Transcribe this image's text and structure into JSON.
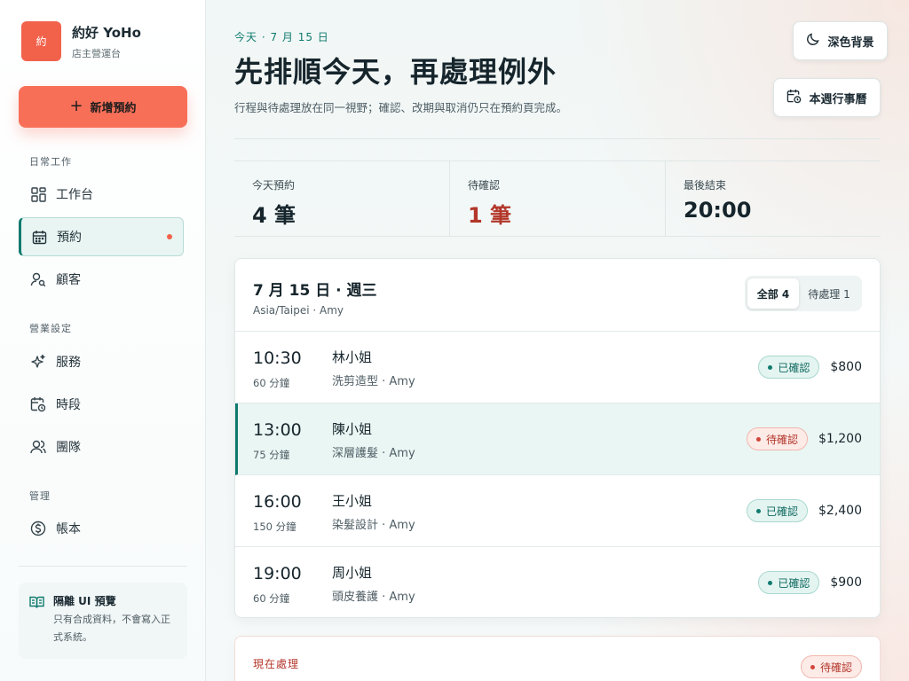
{
  "brand": {
    "logo_text": "約",
    "name": "約好 YoHo",
    "subtitle": "店主營運台",
    "accent": "#f2624b"
  },
  "sidebar": {
    "new_button": "新增預約",
    "sections": [
      {
        "label": "日常工作",
        "items": [
          {
            "label": "工作台",
            "icon": "grid-icon"
          },
          {
            "label": "預約",
            "icon": "calendar-icon",
            "active": true,
            "has_dot": true
          },
          {
            "label": "顧客",
            "icon": "user-search-icon"
          }
        ]
      },
      {
        "label": "營業設定",
        "items": [
          {
            "label": "服務",
            "icon": "sparkles-icon"
          },
          {
            "label": "時段",
            "icon": "calendar-clock-icon"
          },
          {
            "label": "團隊",
            "icon": "users-icon"
          }
        ]
      },
      {
        "label": "管理",
        "items": [
          {
            "label": "帳本",
            "icon": "dollar-circle-icon"
          }
        ]
      }
    ],
    "note": {
      "title": "隔離 UI 預覽",
      "body": "只有合成資料，不會寫入正式系統。",
      "icon": "book-icon"
    }
  },
  "header": {
    "kicker": "今天 · 7 月 15 日",
    "title": "先排順今天，再處理例外",
    "description": "行程與待處理放在同一視野；確認、改期與取消仍只在預約頁完成。",
    "dark_mode_button": "深色背景",
    "week_button": "本週行事曆"
  },
  "stats": [
    {
      "label": "今天預約",
      "value": "4 筆"
    },
    {
      "label": "待確認",
      "value": "1 筆",
      "warn": true
    },
    {
      "label": "最後結束",
      "value": "20:00"
    }
  ],
  "schedule": {
    "date": "7 月 15 日 · 週三",
    "subtitle": "Asia/Taipei · Amy",
    "filters": [
      {
        "label": "全部 4",
        "active": true
      },
      {
        "label": "待處理 1",
        "active": false
      }
    ],
    "appointments": [
      {
        "time": "10:30",
        "duration": "60 分鐘",
        "customer": "林小姐",
        "service": "洗剪造型 · Amy",
        "status": "已確認",
        "status_type": "ok",
        "price": "$800"
      },
      {
        "time": "13:00",
        "duration": "75 分鐘",
        "customer": "陳小姐",
        "service": "深層護髮 · Amy",
        "status": "待確認",
        "status_type": "pending",
        "price": "$1,200",
        "selected": true
      },
      {
        "time": "16:00",
        "duration": "150 分鐘",
        "customer": "王小姐",
        "service": "染髮設計 · Amy",
        "status": "已確認",
        "status_type": "ok",
        "price": "$2,400"
      },
      {
        "time": "19:00",
        "duration": "60 分鐘",
        "customer": "周小姐",
        "service": "頭皮養護 · Amy",
        "status": "已確認",
        "status_type": "ok",
        "price": "$900"
      }
    ]
  },
  "current": {
    "label": "現在處理",
    "status": "待確認"
  },
  "colors": {
    "primary": "#0f7a6e",
    "warn": "#b3362a",
    "cta": "#f86f58"
  }
}
